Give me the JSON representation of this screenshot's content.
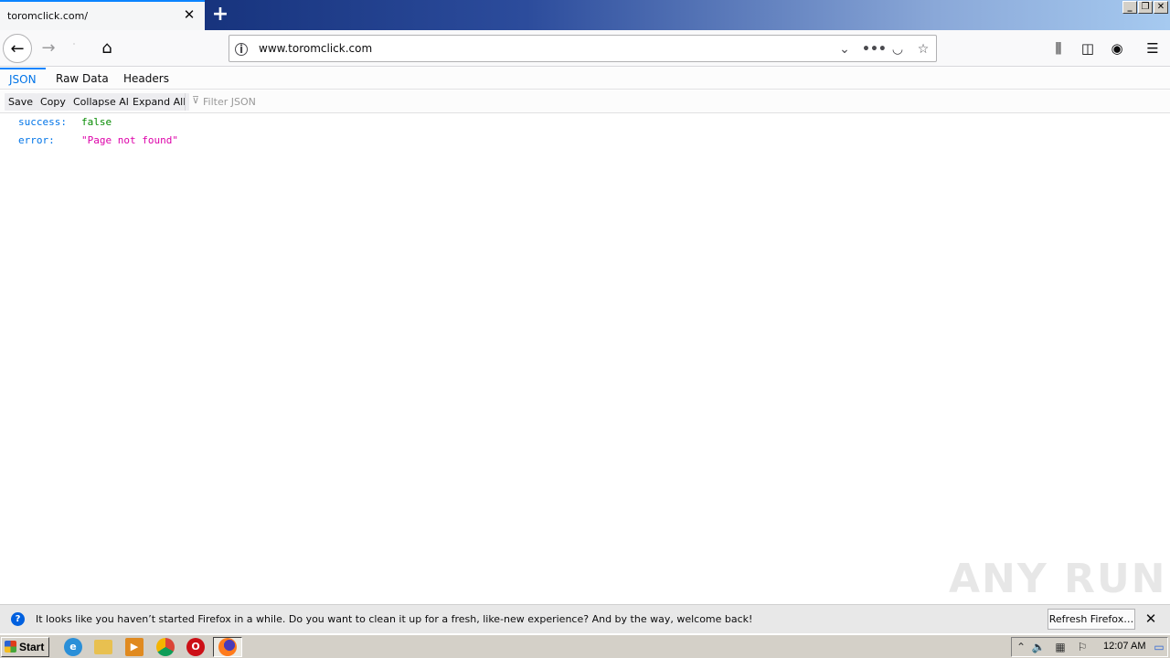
{
  "browser": {
    "tab_title": "toromclick.com/",
    "url": "www.toromclick.com",
    "icons": {
      "back": "arrow-left-icon",
      "forward": "arrow-right-icon",
      "home": "home-icon",
      "new_tab": "plus-icon",
      "library": "library-icon",
      "sidebar": "sidebar-icon",
      "account": "account-icon",
      "menu": "hamburger-menu-icon"
    }
  },
  "json_viewer": {
    "tabs": [
      "JSON",
      "Raw Data",
      "Headers"
    ],
    "active_tab": "JSON",
    "toolbar": {
      "save": "Save",
      "copy": "Copy",
      "collapse_all": "Collapse All",
      "expand_all": "Expand All",
      "filter_placeholder": "Filter JSON"
    },
    "rows": [
      {
        "key": "success:",
        "value": "false",
        "type": "boolean"
      },
      {
        "key": "error:",
        "value": "\"Page not found\"",
        "type": "string"
      }
    ]
  },
  "watermark": "ANY RUN",
  "notification": {
    "message": "It looks like you haven’t started Firefox in a while. Do you want to clean it up for a fresh, like-new experience? And by the way, welcome back!",
    "button": "Refresh Firefox…"
  },
  "taskbar": {
    "start_label": "Start",
    "clock": "12:07 AM"
  },
  "colors": {
    "accent": "#0a84ff",
    "json_key": "#0074e8",
    "json_bool": "#058b00",
    "json_string": "#dd00a9"
  }
}
